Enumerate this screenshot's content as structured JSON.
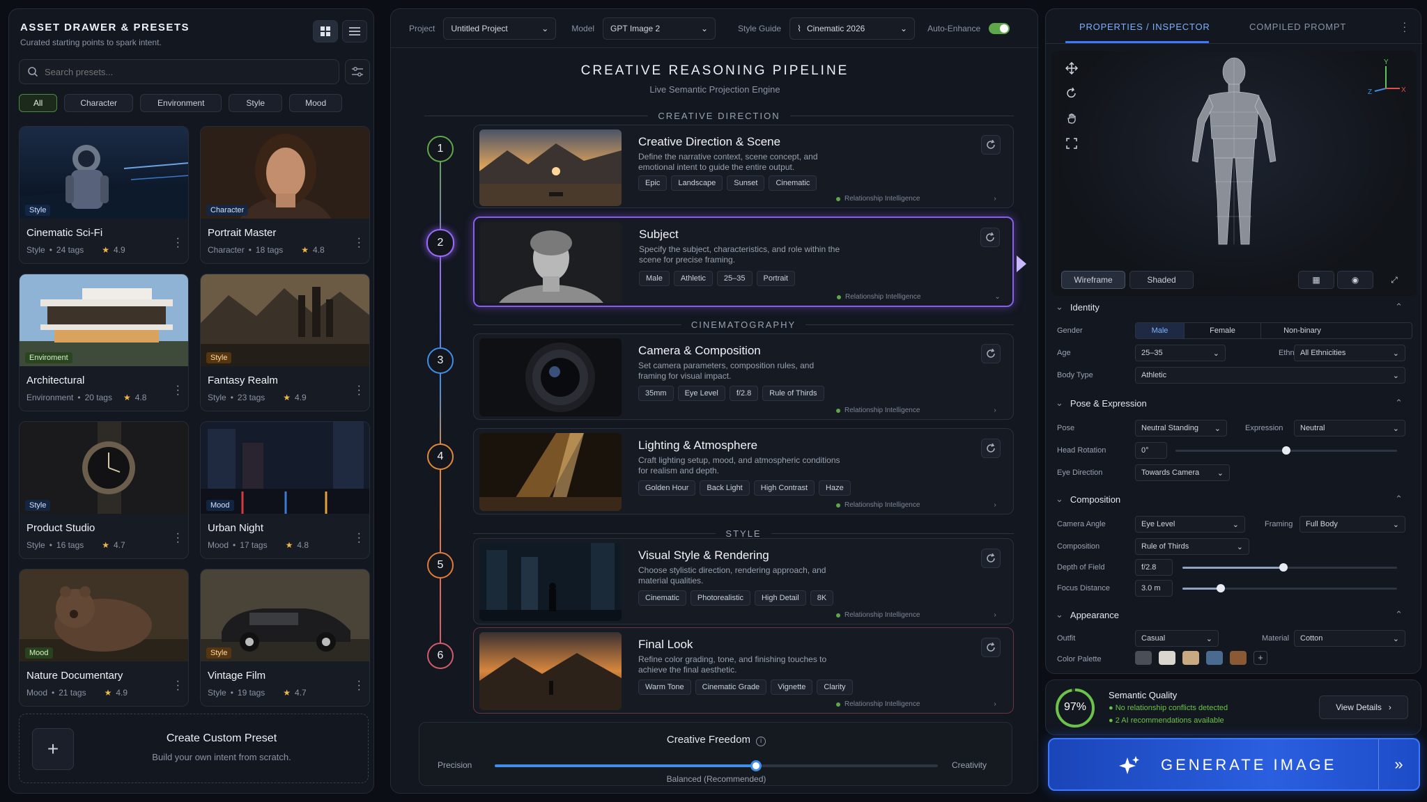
{
  "left": {
    "title": "ASSET DRAWER & PRESETS",
    "subtitle": "Curated starting points to spark intent.",
    "search_placeholder": "Search presets...",
    "filters": [
      "All",
      "Character",
      "Environment",
      "Style",
      "Mood"
    ],
    "cards": [
      {
        "tag": "Style",
        "title": "Cinematic Sci-Fi",
        "category": "Style",
        "tags": "24 tags",
        "rating": "4.9"
      },
      {
        "tag": "Character",
        "title": "Portrait Master",
        "category": "Character",
        "tags": "18 tags",
        "rating": "4.8"
      },
      {
        "tag": "Enviroment",
        "title": "Architectural",
        "category": "Environment",
        "tags": "20 tags",
        "rating": "4.8"
      },
      {
        "tag": "Style",
        "title": "Fantasy Realm",
        "category": "Style",
        "tags": "23 tags",
        "rating": "4.9"
      },
      {
        "tag": "Style",
        "title": "Product Studio",
        "category": "Style",
        "tags": "16 tags",
        "rating": "4.7"
      },
      {
        "tag": "Mood",
        "title": "Urban Night",
        "category": "Mood",
        "tags": "17 tags",
        "rating": "4.8"
      },
      {
        "tag": "Mood",
        "title": "Nature Documentary",
        "category": "Mood",
        "tags": "21 tags",
        "rating": "4.9"
      },
      {
        "tag": "Style",
        "title": "Vintage Film",
        "category": "Style",
        "tags": "19 tags",
        "rating": "4.7"
      }
    ],
    "create_title": "Create Custom Preset",
    "create_sub": "Build your own intent from scratch."
  },
  "topbar": {
    "project_label": "Project",
    "project": "Untitled Project",
    "model_label": "Model",
    "model": "GPT Image 2",
    "style_label": "Style Guide",
    "style": "Cinematic 2026",
    "enhance_label": "Auto-Enhance"
  },
  "pipeline": {
    "title": "CREATIVE REASONING PIPELINE",
    "subtitle": "Live Semantic Projection Engine",
    "sections": [
      "CREATIVE DIRECTION",
      "CINEMATOGRAPHY",
      "STYLE"
    ],
    "ri_label": "Relationship Intelligence",
    "steps": [
      {
        "n": "1",
        "title": "Creative Direction & Scene",
        "desc": "Define the narrative context, scene concept, and emotional intent to guide the entire output.",
        "tags": [
          "Epic",
          "Landscape",
          "Sunset",
          "Cinematic"
        ],
        "color": "#5ea84a"
      },
      {
        "n": "2",
        "title": "Subject",
        "desc": "Specify the subject, characteristics, and role within the scene for precise framing.",
        "tags": [
          "Male",
          "Athletic",
          "25–35",
          "Portrait"
        ],
        "color": "#9b6cf5"
      },
      {
        "n": "3",
        "title": "Camera & Composition",
        "desc": "Set camera parameters, composition rules, and framing for visual impact.",
        "tags": [
          "35mm",
          "Eye Level",
          "f/2.8",
          "Rule of Thirds"
        ],
        "color": "#3f8ee8"
      },
      {
        "n": "4",
        "title": "Lighting & Atmosphere",
        "desc": "Craft lighting setup, mood, and atmospheric conditions for realism and depth.",
        "tags": [
          "Golden Hour",
          "Back Light",
          "High Contrast",
          "Haze"
        ],
        "color": "#e2893a"
      },
      {
        "n": "5",
        "title": "Visual Style & Rendering",
        "desc": "Choose stylistic direction, rendering approach, and material qualities.",
        "tags": [
          "Cinematic",
          "Photorealistic",
          "High Detail",
          "8K"
        ],
        "color": "#e07a3a"
      },
      {
        "n": "6",
        "title": "Final Look",
        "desc": "Refine color grading, tone, and finishing touches to achieve the final aesthetic.",
        "tags": [
          "Warm Tone",
          "Cinematic Grade",
          "Vignette",
          "Clarity"
        ],
        "color": "#d55a6e"
      }
    ],
    "freedom": {
      "title": "Creative Freedom",
      "left": "Precision",
      "right": "Creativity",
      "note": "Balanced (Recommended)",
      "value": 0.59
    }
  },
  "inspector": {
    "tab1": "PROPERTIES / INSPECTOR",
    "tab2": "COMPILED PROMPT",
    "view_wire": "Wireframe",
    "view_shaded": "Shaded",
    "identity": {
      "title": "Identity",
      "gender_label": "Gender",
      "genders": [
        "Male",
        "Female",
        "Non-binary"
      ],
      "age_label": "Age",
      "age": "25–35",
      "eth_label": "Ethnicity",
      "eth": "All Ethnicities",
      "body_label": "Body Type",
      "body": "Athletic"
    },
    "pose": {
      "title": "Pose & Expression",
      "pose_label": "Pose",
      "pose": "Neutral Standing",
      "expr_label": "Expression",
      "expr": "Neutral",
      "rot_label": "Head Rotation",
      "rot": "0°",
      "rot_value": 0.5,
      "eye_label": "Eye Direction",
      "eye": "Towards Camera"
    },
    "comp": {
      "title": "Composition",
      "angle_label": "Camera Angle",
      "angle": "Eye Level",
      "framing_label": "Framing",
      "framing": "Full Body",
      "comp_label": "Composition",
      "comp": "Rule of Thirds",
      "dof_label": "Depth of Field",
      "dof": "f/2.8",
      "dof_value": 0.47,
      "focus_label": "Focus Distance",
      "focus": "3.0 m",
      "focus_value": 0.18
    },
    "app": {
      "title": "Appearance",
      "outfit_label": "Outfit",
      "outfit": "Casual",
      "mat_label": "Material",
      "mat": "Cotton",
      "palette_label": "Color Palette",
      "palette": [
        "#4a4e56",
        "#d9d6d0",
        "#c9a982",
        "#4a6a90",
        "#8a5a34"
      ]
    }
  },
  "quality": {
    "pct": "97%",
    "title": "Semantic Quality",
    "l1": "No relationship conflicts detected",
    "l2": "2 AI recommendations available",
    "btn": "View Details",
    "value": 0.97
  },
  "generate": "GENERATE IMAGE"
}
